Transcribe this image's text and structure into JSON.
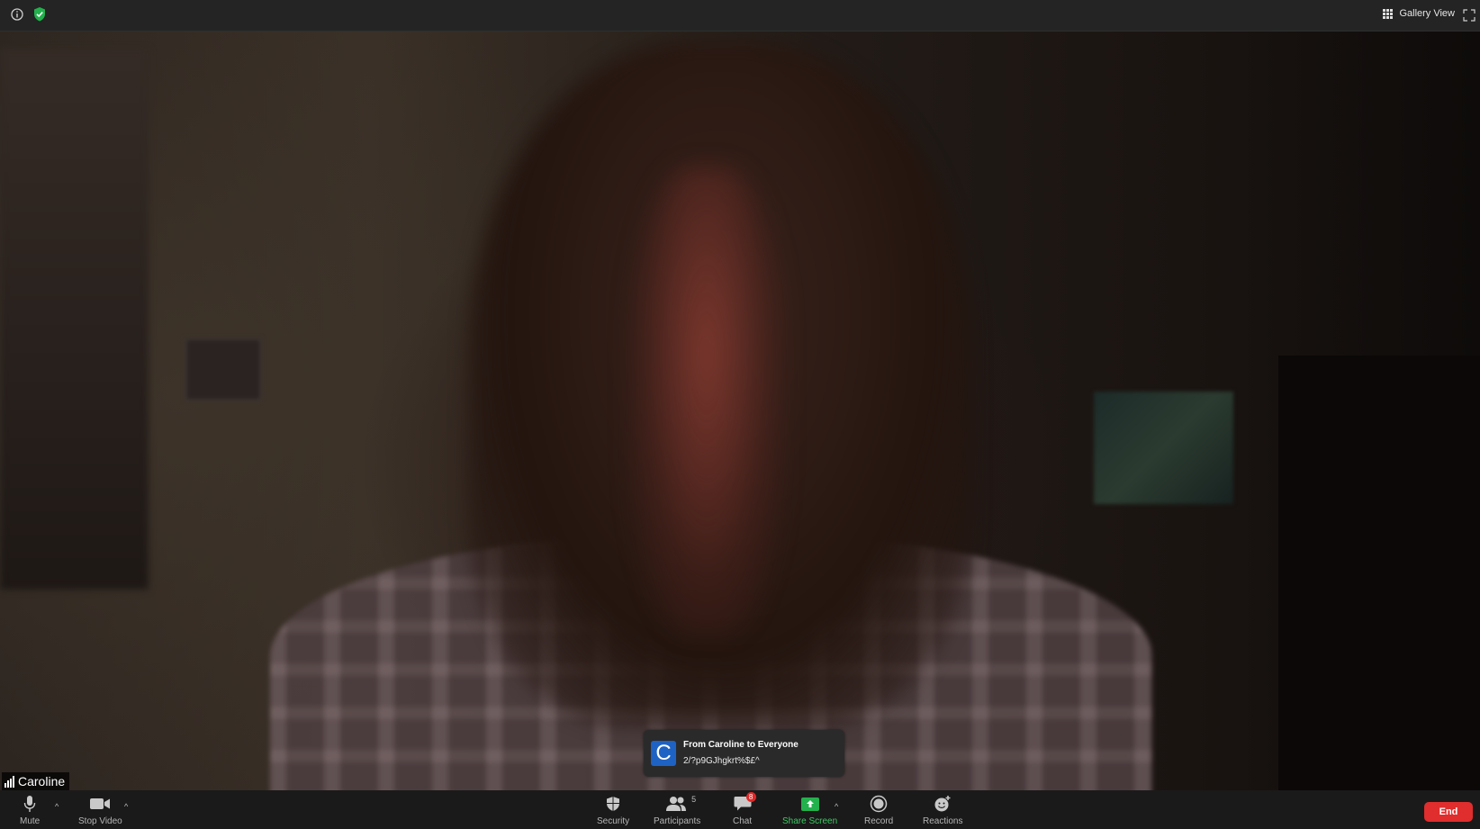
{
  "topbar": {
    "icons": [
      "info-icon",
      "shield-check-icon"
    ],
    "view_button_label": "Gallery View",
    "view_icon": "grid-icon",
    "fullscreen_icon": "fullscreen-icon",
    "shield_color": "#23b14d"
  },
  "video": {
    "participant_name": "Caroline"
  },
  "chat_toast": {
    "avatar_letter": "C",
    "from": "From Caroline to Everyone",
    "message": "2/?p9GJhgkrt%$£^",
    "avatar_color": "#1e62c4"
  },
  "toolbar": {
    "mute_label": "Mute",
    "stop_video_label": "Stop Video",
    "security_label": "Security",
    "participants_label": "Participants",
    "participants_count": "5",
    "chat_label": "Chat",
    "chat_badge": "8",
    "share_screen_label": "Share Screen",
    "record_label": "Record",
    "reactions_label": "Reactions",
    "end_label": "End",
    "end_color": "#e02d2d",
    "share_color": "#23b14d"
  }
}
